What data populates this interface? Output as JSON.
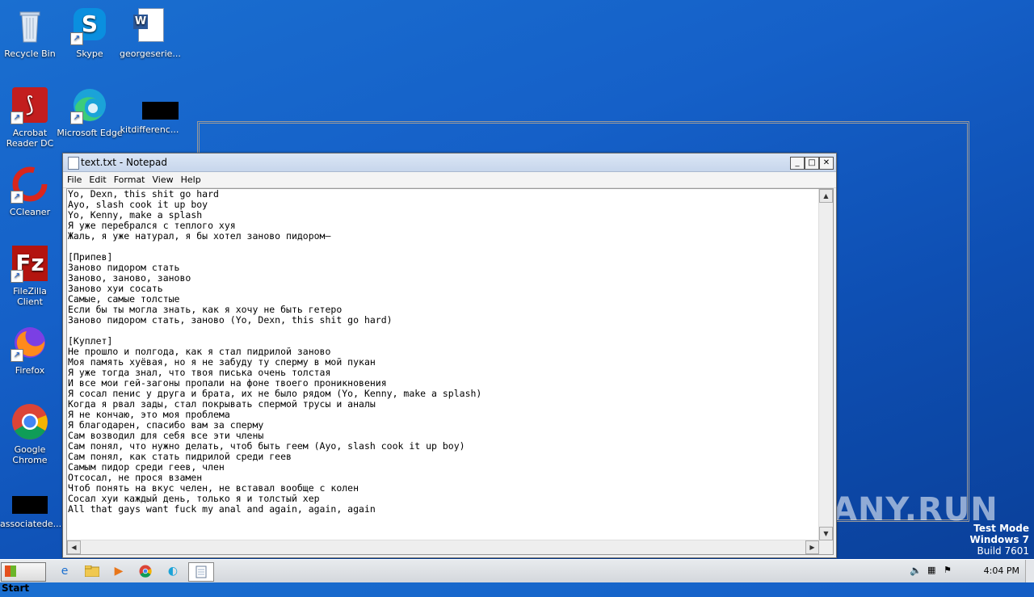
{
  "desktop": {
    "icons": [
      {
        "label": "Recycle Bin",
        "icon": "recycle-bin-icon"
      },
      {
        "label": "Skype",
        "icon": "skype-icon"
      },
      {
        "label": "georgeserie...",
        "icon": "word-document-icon"
      },
      {
        "label": "Acrobat Reader DC",
        "icon": "acrobat-icon"
      },
      {
        "label": "Microsoft Edge",
        "icon": "edge-icon"
      },
      {
        "label": "kitdifferenc...",
        "icon": "black-file-icon"
      },
      {
        "label": "CCleaner",
        "icon": "ccleaner-icon"
      },
      {
        "label": "FileZilla Client",
        "icon": "filezilla-icon"
      },
      {
        "label": "Firefox",
        "icon": "firefox-icon"
      },
      {
        "label": "Google Chrome",
        "icon": "chrome-icon"
      },
      {
        "label": "associatede...",
        "icon": "black-file-icon"
      }
    ],
    "watermark": "ANY.RUN",
    "test_mode": {
      "line1": "Test Mode",
      "line2": "Windows 7",
      "line3": "Build 7601"
    }
  },
  "notepad": {
    "title": "text.txt - Notepad",
    "menu": [
      "File",
      "Edit",
      "Format",
      "View",
      "Help"
    ],
    "content": "Yo, Dexn, this shit go hard\nAyo, slash cook it up boy\nYo, Kenny, make a splash\nЯ уже перебрался с теплого хуя\nЖаль, я уже натурал, я бы хотел заново пидором—\n\n[Припев]\nЗаново пидором стать\nЗаново, заново, заново\nЗаново хуи сосать\nСамые, самые толстые\nЕсли бы ты могла знать, как я хочу не быть гетеро\nЗаново пидором стать, заново (Yo, Dexn, this shit go hard)\n\n[Куплет]\nНе прошло и полгода, как я стал пидрилой заново\nМоя память хуёвая, но я не забуду ту сперму в мой пукан\nЯ уже тогда знал, что твоя писька очень толстая\nИ все мои гей-загоны пропали на фоне твоего проникновения\nЯ сосал пенис у друга и брата, их не было рядом (Yo, Kenny, make a splash)\nКогда я рвал зады, стал покрывать спермой трусы и аналы\nЯ не кончаю, это моя проблема\nЯ благодарен, спасибо вам за сперму\nСам возводил для себя все эти члены\nСам понял, что нужно делать, чтоб быть геем (Ayo, slash cook it up boy)\nСам понял, как стать пидрилой среди геев\nСамым пидор среди геев, член\nОтсосал, не прося взамен\nЧтоб понять на вкус челен, не вставал вообще с колен\nСосал хуи каждый день, только я и толстый хер\nAll that gays want fuck my anal and again, again, again"
  },
  "taskbar": {
    "start_label": "Start",
    "clock": "4:04 PM"
  }
}
